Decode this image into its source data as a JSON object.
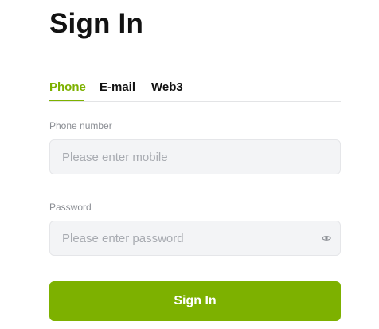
{
  "title": "Sign In",
  "tabs": [
    {
      "label": "Phone",
      "active": true
    },
    {
      "label": "E-mail",
      "active": false
    },
    {
      "label": "Web3",
      "active": false
    }
  ],
  "phone": {
    "label": "Phone number",
    "placeholder": "Please enter mobile",
    "value": ""
  },
  "password": {
    "label": "Password",
    "placeholder": "Please enter password",
    "value": "",
    "toggle_icon": "eye-icon"
  },
  "submit": {
    "label": "Sign In"
  },
  "colors": {
    "accent": "#7db100",
    "field_bg": "#f3f4f6",
    "label": "#8a8d93",
    "text": "#121212"
  }
}
